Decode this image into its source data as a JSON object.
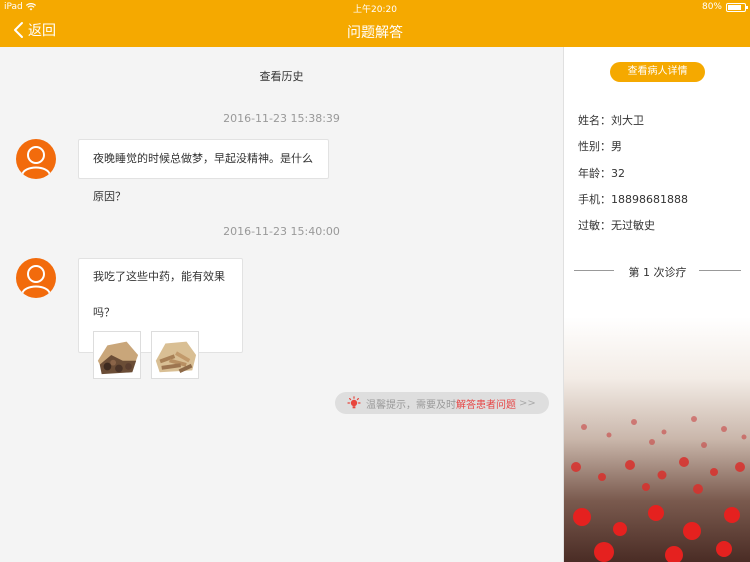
{
  "status_bar": {
    "carrier": "iPad",
    "time": "上午20:20",
    "battery": "80%",
    "battery_level": 0.8
  },
  "nav": {
    "back_label": "返回",
    "title": "问题解答"
  },
  "chat": {
    "history_label": "查看历史",
    "messages": [
      {
        "timestamp": "2016-11-23  15:38:39",
        "text": "夜晚睡觉的时候总做梦，早起没精神。是什么原因？",
        "images": []
      },
      {
        "timestamp": "2016-11-23  15:40:00",
        "text": "我吃了这些中药，能有效果吗？",
        "images": [
          "herb-photo-1",
          "herb-photo-2"
        ]
      }
    ],
    "tip": {
      "prefix": "温馨提示，需要及时",
      "highlight": "解答患者问题",
      "arrow": ">>"
    }
  },
  "patient": {
    "detail_button": "查看病人详情",
    "fields": [
      {
        "label": "姓名：",
        "value": "刘大卫"
      },
      {
        "label": "性别：",
        "value": "男"
      },
      {
        "label": "年龄：",
        "value": "32"
      },
      {
        "label": "手机：",
        "value": "18898681888"
      },
      {
        "label": "过敏：",
        "value": "无过敏史"
      }
    ],
    "visit_label": "第 1 次诊疗"
  },
  "colors": {
    "accent": "#f5a900",
    "avatar": "#f26b0c",
    "highlight": "#e64545"
  }
}
